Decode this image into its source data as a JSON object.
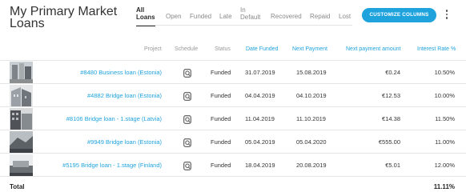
{
  "page": {
    "title": "My Primary Market Loans"
  },
  "tabs": [
    {
      "label": "All Loans",
      "active": true
    },
    {
      "label": "Open",
      "active": false
    },
    {
      "label": "Funded",
      "active": false
    },
    {
      "label": "Late",
      "active": false
    },
    {
      "label": "In Default",
      "active": false
    },
    {
      "label": "Recovered",
      "active": false
    },
    {
      "label": "Repaid",
      "active": false
    },
    {
      "label": "Lost",
      "active": false
    }
  ],
  "toolbar": {
    "customize_label": "CUSTOMIZE COLUMNS",
    "more_icon": "kebab-vertical-icon"
  },
  "table": {
    "headers": {
      "project": "Project",
      "schedule": "Schedule",
      "status": "Status",
      "date_funded": "Date Funded",
      "next_payment": "Next Payment",
      "next_payment_amount": "Next payment amount",
      "interest_rate": "Interest Rate %"
    },
    "rows": [
      {
        "project": "#8480 Business loan (Estonia)",
        "schedule_icon": "schedule-icon",
        "status": "Funded",
        "date_funded": "31.07.2019",
        "next_payment": "15.08.2019",
        "next_payment_amount": "€0.24",
        "interest_rate": "10.50%"
      },
      {
        "project": "#4882 Bridge loan (Estonia)",
        "schedule_icon": "schedule-icon",
        "status": "Funded",
        "date_funded": "04.04.2019",
        "next_payment": "04.10.2019",
        "next_payment_amount": "€12.53",
        "interest_rate": "10.00%"
      },
      {
        "project": "#8106 Bridge loan - 1.stage (Latvia)",
        "schedule_icon": "schedule-icon",
        "status": "Funded",
        "date_funded": "11.04.2019",
        "next_payment": "11.10.2019",
        "next_payment_amount": "€14.38",
        "interest_rate": "11.50%"
      },
      {
        "project": "#9949 Bridge loan (Estonia)",
        "schedule_icon": "schedule-icon",
        "status": "Funded",
        "date_funded": "05.04.2019",
        "next_payment": "05.04.2020",
        "next_payment_amount": "€555.00",
        "interest_rate": "11.00%"
      },
      {
        "project": "#5195 Bridge loan - 1.stage (Finland)",
        "schedule_icon": "schedule-icon",
        "status": "Funded",
        "date_funded": "18.04.2019",
        "next_payment": "20.08.2019",
        "next_payment_amount": "€5.01",
        "interest_rate": "12.00%"
      }
    ],
    "total": {
      "label": "Total",
      "interest_rate": "11.11%"
    }
  },
  "colors": {
    "accent": "#1fa3dd",
    "text": "#333333",
    "muted": "#999999"
  }
}
